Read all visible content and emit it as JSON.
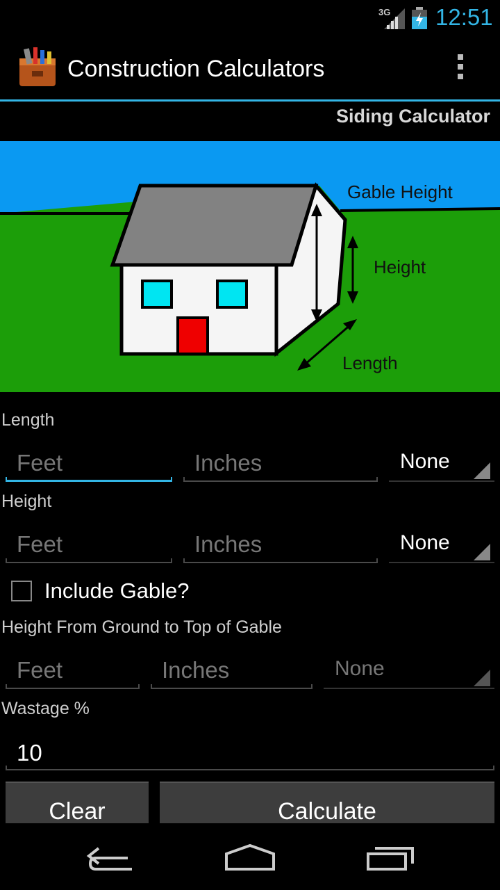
{
  "status_bar": {
    "network": "3G",
    "time": "12:51",
    "icons": [
      "signal-icon",
      "battery-charging-icon"
    ]
  },
  "action_bar": {
    "title": "Construction Calculators",
    "app_icon": "toolbox-icon",
    "overflow_icon": "overflow-menu-icon"
  },
  "subtitle": "Siding Calculator",
  "diagram": {
    "labels": {
      "gable_height": "Gable Height",
      "height": "Height",
      "length": "Length"
    },
    "colors": {
      "sky": "#0a99f2",
      "grass": "#1c9e09",
      "roof": "#828282",
      "wall": "#f5f5f5",
      "window": "#00e5f2",
      "door": "#ef0000"
    }
  },
  "form": {
    "length": {
      "label": "Length",
      "feet_placeholder": "Feet",
      "inches_placeholder": "Inches",
      "unit_selected": "None"
    },
    "height": {
      "label": "Height",
      "feet_placeholder": "Feet",
      "inches_placeholder": "Inches",
      "unit_selected": "None"
    },
    "include_gable": {
      "label": "Include Gable?",
      "checked": false
    },
    "gable": {
      "label": "Height From Ground to Top of Gable",
      "feet_placeholder": "Feet",
      "inches_placeholder": "Inches",
      "unit_selected": "None"
    },
    "wastage": {
      "label": "Wastage %",
      "value": "10"
    },
    "buttons": {
      "clear": "Clear",
      "calculate": "Calculate"
    }
  },
  "nav_bar": {
    "icons": [
      "back-icon",
      "home-icon",
      "recent-apps-icon"
    ]
  },
  "accent_color": "#33b5e5"
}
